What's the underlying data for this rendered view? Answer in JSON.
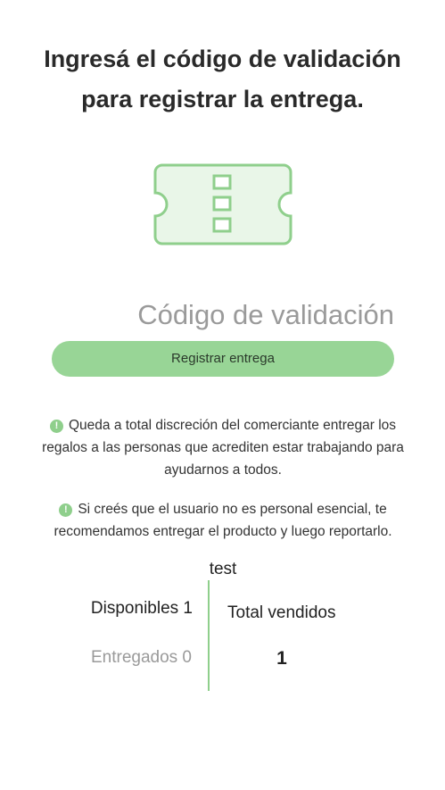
{
  "header": {
    "title_line1": "Ingresá el código de validación",
    "title_line2": "para registrar la entrega."
  },
  "ticket_icon": "ticket-icon",
  "form": {
    "code_placeholder": "Código de validación",
    "code_value": "",
    "submit_label": "Registrar entrega"
  },
  "info": [
    {
      "icon": "alert-icon",
      "text": "Queda a total discreción del comerciante entregar los regalos a las personas que acrediten estar trabajando para ayudarnos a todos."
    },
    {
      "icon": "alert-icon",
      "text": "Si creés que el usuario no es personal esencial, te recomendamos entregar el producto y luego reportarlo."
    }
  ],
  "stats": {
    "title": "test",
    "available_label": "Disponibles 1",
    "delivered_label": "Entregados 0",
    "total_sold_label": "Total vendidos",
    "total_sold_value": "1"
  },
  "colors": {
    "accent": "#98d596",
    "accent_dark": "#8fcf8c",
    "icon_fill": "#e9f6e8"
  }
}
